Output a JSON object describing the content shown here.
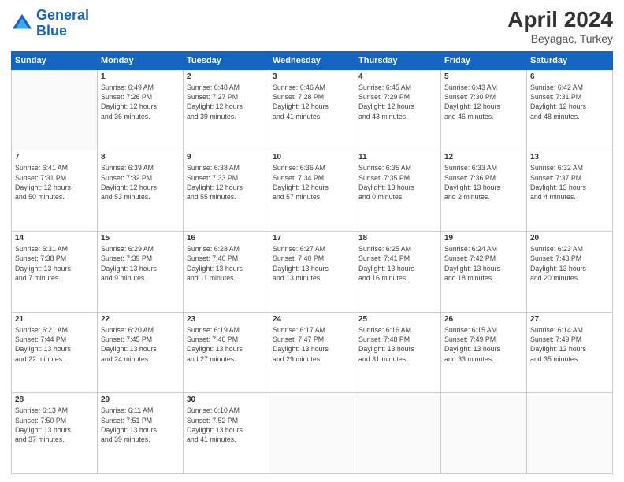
{
  "header": {
    "logo_line1": "General",
    "logo_line2": "Blue",
    "main_title": "April 2024",
    "subtitle": "Beyagac, Turkey"
  },
  "days_of_week": [
    "Sunday",
    "Monday",
    "Tuesday",
    "Wednesday",
    "Thursday",
    "Friday",
    "Saturday"
  ],
  "weeks": [
    [
      {
        "num": "",
        "info": ""
      },
      {
        "num": "1",
        "info": "Sunrise: 6:49 AM\nSunset: 7:26 PM\nDaylight: 12 hours\nand 36 minutes."
      },
      {
        "num": "2",
        "info": "Sunrise: 6:48 AM\nSunset: 7:27 PM\nDaylight: 12 hours\nand 39 minutes."
      },
      {
        "num": "3",
        "info": "Sunrise: 6:46 AM\nSunset: 7:28 PM\nDaylight: 12 hours\nand 41 minutes."
      },
      {
        "num": "4",
        "info": "Sunrise: 6:45 AM\nSunset: 7:29 PM\nDaylight: 12 hours\nand 43 minutes."
      },
      {
        "num": "5",
        "info": "Sunrise: 6:43 AM\nSunset: 7:30 PM\nDaylight: 12 hours\nand 46 minutes."
      },
      {
        "num": "6",
        "info": "Sunrise: 6:42 AM\nSunset: 7:31 PM\nDaylight: 12 hours\nand 48 minutes."
      }
    ],
    [
      {
        "num": "7",
        "info": "Sunrise: 6:41 AM\nSunset: 7:31 PM\nDaylight: 12 hours\nand 50 minutes."
      },
      {
        "num": "8",
        "info": "Sunrise: 6:39 AM\nSunset: 7:32 PM\nDaylight: 12 hours\nand 53 minutes."
      },
      {
        "num": "9",
        "info": "Sunrise: 6:38 AM\nSunset: 7:33 PM\nDaylight: 12 hours\nand 55 minutes."
      },
      {
        "num": "10",
        "info": "Sunrise: 6:36 AM\nSunset: 7:34 PM\nDaylight: 12 hours\nand 57 minutes."
      },
      {
        "num": "11",
        "info": "Sunrise: 6:35 AM\nSunset: 7:35 PM\nDaylight: 13 hours\nand 0 minutes."
      },
      {
        "num": "12",
        "info": "Sunrise: 6:33 AM\nSunset: 7:36 PM\nDaylight: 13 hours\nand 2 minutes."
      },
      {
        "num": "13",
        "info": "Sunrise: 6:32 AM\nSunset: 7:37 PM\nDaylight: 13 hours\nand 4 minutes."
      }
    ],
    [
      {
        "num": "14",
        "info": "Sunrise: 6:31 AM\nSunset: 7:38 PM\nDaylight: 13 hours\nand 7 minutes."
      },
      {
        "num": "15",
        "info": "Sunrise: 6:29 AM\nSunset: 7:39 PM\nDaylight: 13 hours\nand 9 minutes."
      },
      {
        "num": "16",
        "info": "Sunrise: 6:28 AM\nSunset: 7:40 PM\nDaylight: 13 hours\nand 11 minutes."
      },
      {
        "num": "17",
        "info": "Sunrise: 6:27 AM\nSunset: 7:40 PM\nDaylight: 13 hours\nand 13 minutes."
      },
      {
        "num": "18",
        "info": "Sunrise: 6:25 AM\nSunset: 7:41 PM\nDaylight: 13 hours\nand 16 minutes."
      },
      {
        "num": "19",
        "info": "Sunrise: 6:24 AM\nSunset: 7:42 PM\nDaylight: 13 hours\nand 18 minutes."
      },
      {
        "num": "20",
        "info": "Sunrise: 6:23 AM\nSunset: 7:43 PM\nDaylight: 13 hours\nand 20 minutes."
      }
    ],
    [
      {
        "num": "21",
        "info": "Sunrise: 6:21 AM\nSunset: 7:44 PM\nDaylight: 13 hours\nand 22 minutes."
      },
      {
        "num": "22",
        "info": "Sunrise: 6:20 AM\nSunset: 7:45 PM\nDaylight: 13 hours\nand 24 minutes."
      },
      {
        "num": "23",
        "info": "Sunrise: 6:19 AM\nSunset: 7:46 PM\nDaylight: 13 hours\nand 27 minutes."
      },
      {
        "num": "24",
        "info": "Sunrise: 6:17 AM\nSunset: 7:47 PM\nDaylight: 13 hours\nand 29 minutes."
      },
      {
        "num": "25",
        "info": "Sunrise: 6:16 AM\nSunset: 7:48 PM\nDaylight: 13 hours\nand 31 minutes."
      },
      {
        "num": "26",
        "info": "Sunrise: 6:15 AM\nSunset: 7:49 PM\nDaylight: 13 hours\nand 33 minutes."
      },
      {
        "num": "27",
        "info": "Sunrise: 6:14 AM\nSunset: 7:49 PM\nDaylight: 13 hours\nand 35 minutes."
      }
    ],
    [
      {
        "num": "28",
        "info": "Sunrise: 6:13 AM\nSunset: 7:50 PM\nDaylight: 13 hours\nand 37 minutes."
      },
      {
        "num": "29",
        "info": "Sunrise: 6:11 AM\nSunset: 7:51 PM\nDaylight: 13 hours\nand 39 minutes."
      },
      {
        "num": "30",
        "info": "Sunrise: 6:10 AM\nSunset: 7:52 PM\nDaylight: 13 hours\nand 41 minutes."
      },
      {
        "num": "",
        "info": ""
      },
      {
        "num": "",
        "info": ""
      },
      {
        "num": "",
        "info": ""
      },
      {
        "num": "",
        "info": ""
      }
    ]
  ]
}
